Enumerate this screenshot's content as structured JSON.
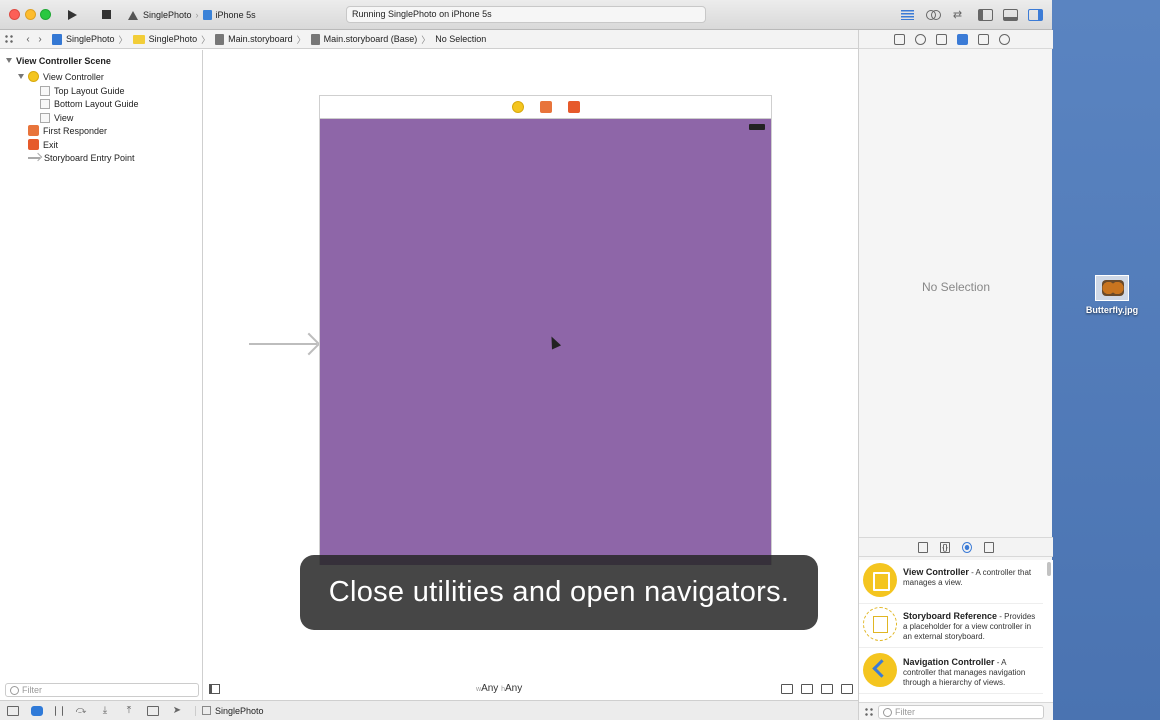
{
  "toolbar": {
    "scheme_app": "SinglePhoto",
    "scheme_device": "iPhone 5s",
    "activity_status": "Running SinglePhoto on iPhone 5s"
  },
  "jumpbar": {
    "crumbs": [
      "SinglePhoto",
      "SinglePhoto",
      "Main.storyboard",
      "Main.storyboard (Base)",
      "No Selection"
    ]
  },
  "navigator": {
    "scene": "View Controller Scene",
    "view_controller": "View Controller",
    "top_layout_guide": "Top Layout Guide",
    "bottom_layout_guide": "Bottom Layout Guide",
    "view": "View",
    "first_responder": "First Responder",
    "exit": "Exit",
    "entry_point": "Storyboard Entry Point",
    "filter_placeholder": "Filter"
  },
  "canvas": {
    "view_color": "#8e66a8",
    "caption": "Close utilities and open navigators.",
    "size_w_prefix": "w",
    "size_w": "Any",
    "size_h_prefix": "h",
    "size_h": "Any"
  },
  "inspector": {
    "no_selection": "No Selection"
  },
  "library": {
    "items": [
      {
        "title": "View Controller",
        "desc": " - A controller that manages a view."
      },
      {
        "title": "Storyboard Reference",
        "desc": " - Provides a placeholder for a view controller in an external storyboard."
      },
      {
        "title": "Navigation Controller",
        "desc": " - A controller that manages navigation through a hierarchy of views."
      }
    ],
    "filter_placeholder": "Filter"
  },
  "debug": {
    "target": "SinglePhoto"
  },
  "desktop": {
    "file_name": "Butterfly.jpg"
  },
  "colors": {
    "accent": "#3b7bd6",
    "desktop": "#4f79b5"
  },
  "icons": [
    "run-icon",
    "stop-icon",
    "grid-icon",
    "back-icon",
    "forward-icon",
    "view-controller-icon",
    "first-responder-icon",
    "exit-icon",
    "entry-arrow-icon",
    "battery-icon"
  ]
}
